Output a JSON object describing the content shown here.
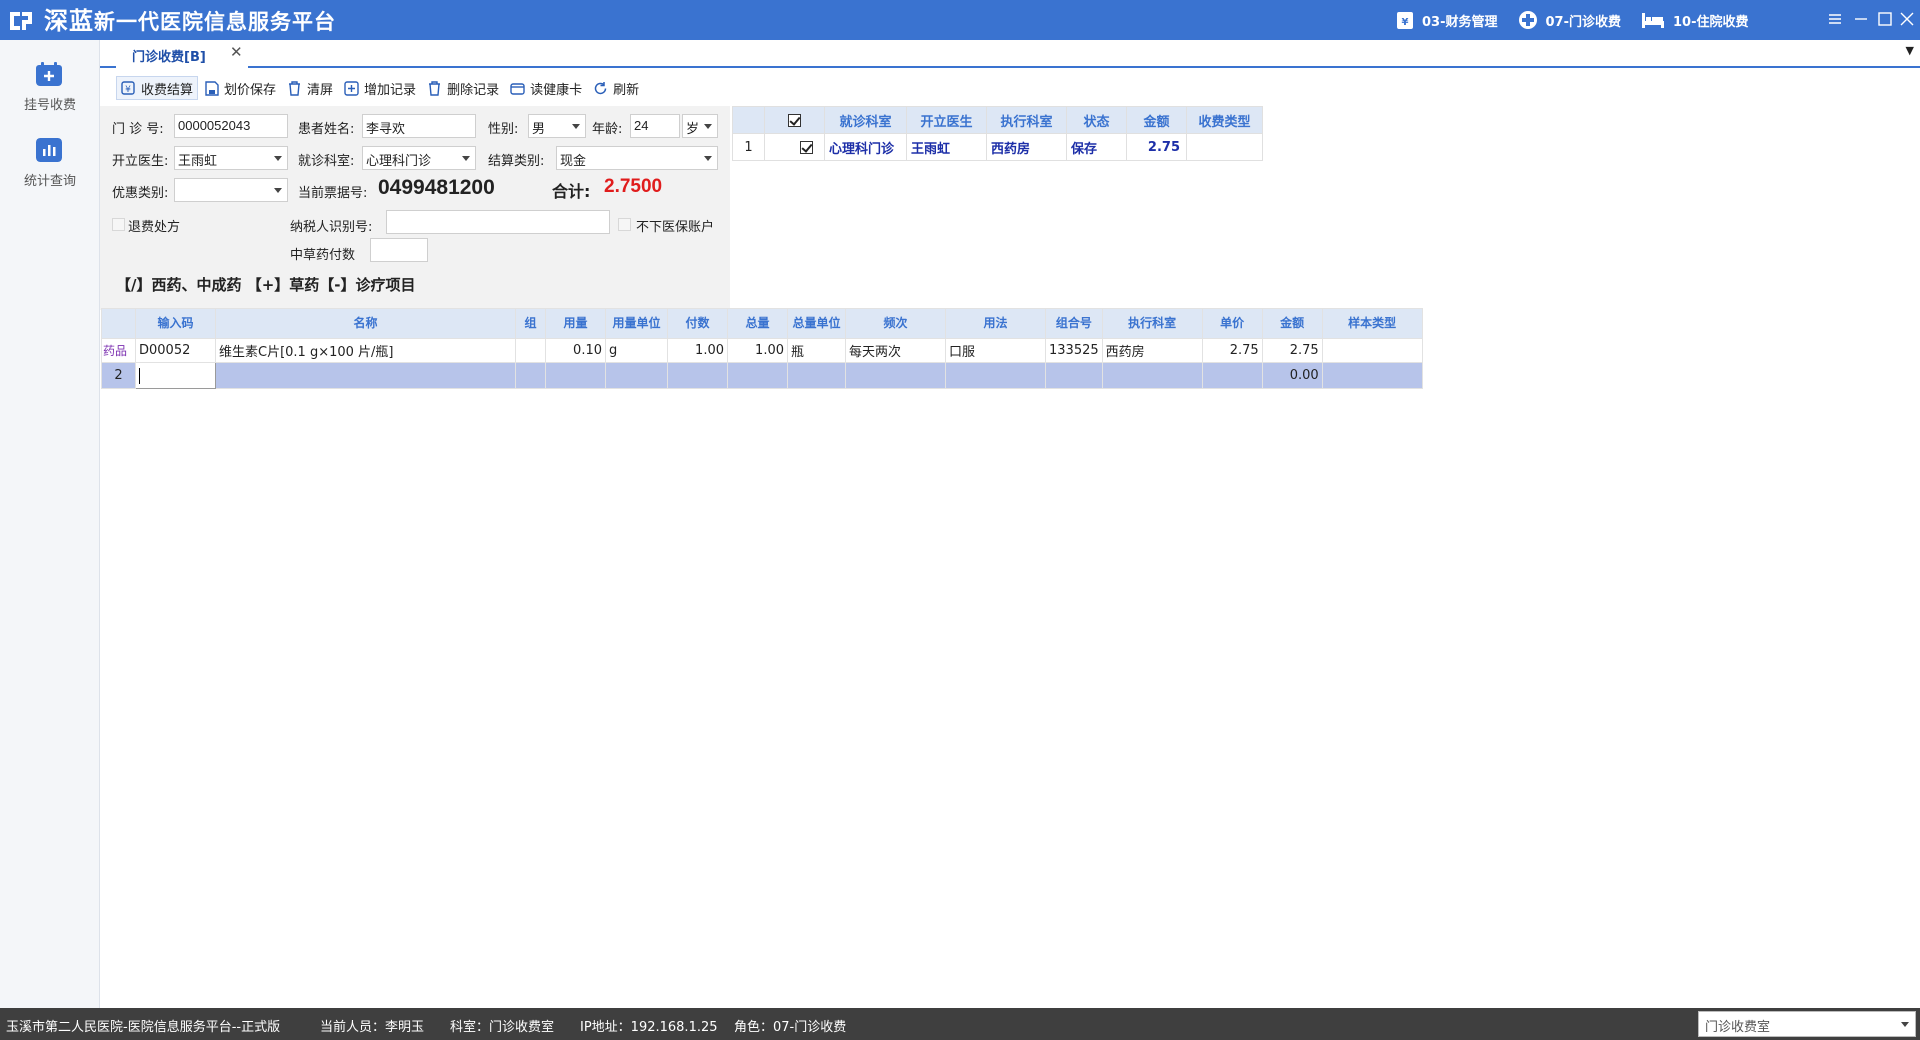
{
  "app": {
    "title_brand": "深蓝",
    "title_rest": "新一代医院信息服务平台",
    "modules": [
      {
        "label": "03-财务管理",
        "icon": "finance-icon"
      },
      {
        "label": "07-门诊收费",
        "icon": "medical-cross-icon"
      },
      {
        "label": "10-住院收费",
        "icon": "bed-icon"
      }
    ]
  },
  "sidebar": {
    "items": [
      {
        "label": "挂号收费",
        "icon": "register-calendar-icon"
      },
      {
        "label": "统计查询",
        "icon": "bar-chart-icon"
      }
    ]
  },
  "tabs": [
    {
      "label": "门诊收费[B]",
      "active": true
    }
  ],
  "toolbar": {
    "settle": "收费结算",
    "save_price": "划价保存",
    "clear": "清屏",
    "add_record": "增加记录",
    "delete_record": "删除记录",
    "read_card": "读健康卡",
    "refresh": "刷新"
  },
  "form": {
    "clinic_no_label": "门  诊 号:",
    "clinic_no": "0000052043",
    "patient_name_label": "患者姓名:",
    "patient_name": "李寻欢",
    "gender_label": "性别:",
    "gender": "男",
    "age_label": "年龄:",
    "age": "24",
    "age_unit": "岁",
    "doctor_label": "开立医生:",
    "doctor": "王雨虹",
    "dept_label": "就诊科室:",
    "dept": "心理科门诊",
    "settle_type_label": "结算类别:",
    "settle_type": "现金",
    "discount_label": "优惠类别:",
    "discount": "",
    "ticket_label": "当前票据号:",
    "ticket_no": "0499481200",
    "total_label": "合计:",
    "total": "2.7500",
    "refund_label": "退费处方",
    "taxpayer_label": "纳税人识别号:",
    "taxpayer": "",
    "no_insurance_label": "不下医保账户",
    "herbal_label": "中草药付数",
    "herbal": "",
    "hint": "【/】西药、中成药 【+】草药【-】诊疗项目"
  },
  "right_grid": {
    "headers": [
      "就诊科室",
      "开立医生",
      "执行科室",
      "状态",
      "金额",
      "收费类型"
    ],
    "rows": [
      {
        "no": "1",
        "dept": "心理科门诊",
        "doctor": "王雨虹",
        "exec_dept": "西药房",
        "status": "保存",
        "amount": "2.75",
        "fee_type": ""
      }
    ]
  },
  "main_grid": {
    "headers": [
      "输入码",
      "名称",
      "组",
      "用量",
      "用量单位",
      "付数",
      "总量",
      "总量单位",
      "频次",
      "用法",
      "组合号",
      "执行科室",
      "单价",
      "金额",
      "样本类型"
    ],
    "rows": [
      {
        "tag": "药品",
        "code": "D00052",
        "name": "维生素C片[0.1 g×100 片/瓶]",
        "group": "",
        "dose": "0.10",
        "dose_unit": "g",
        "times": "1.00",
        "total": "1.00",
        "total_unit": "瓶",
        "freq": "每天两次",
        "usage": "口服",
        "combo": "133525",
        "exec": "西药房",
        "price": "2.75",
        "amount": "2.75",
        "sample": ""
      }
    ],
    "new_row": {
      "no": "2",
      "amount": "0.00"
    }
  },
  "status": {
    "hospital": "玉溪市第二人民医院-医院信息服务平台--正式版",
    "user": "当前人员：李明玉",
    "dept": "科室：门诊收费室",
    "ip": "IP地址：192.168.1.25",
    "role": "角色：07-门诊收费",
    "room": "门诊收费室"
  },
  "colors": {
    "accent": "#3a73d0",
    "header_bg": "#dde7f5",
    "total": "#e01c1c",
    "selected_row": "#b7c4ea"
  }
}
